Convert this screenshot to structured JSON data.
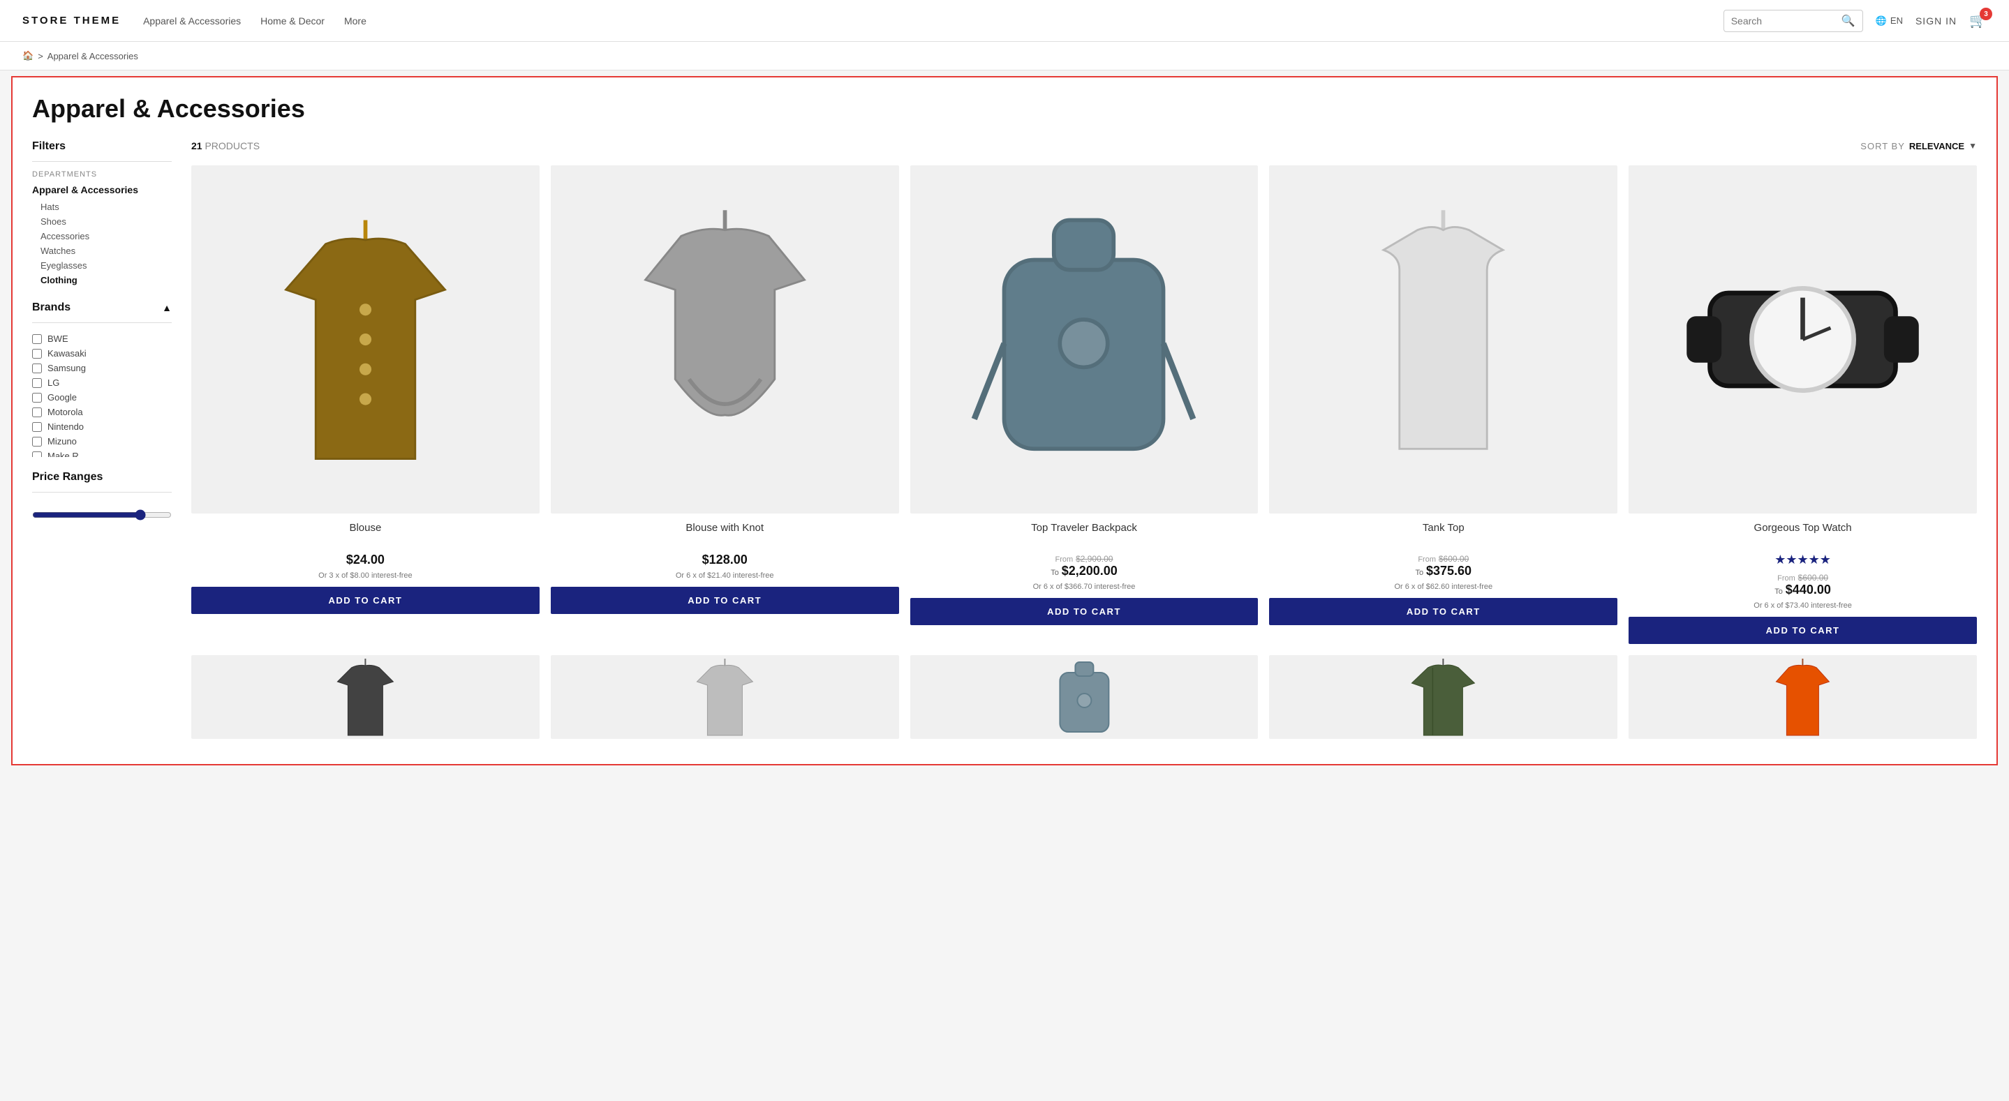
{
  "header": {
    "logo": "STORE THEME",
    "nav": [
      {
        "label": "Apparel & Accessories"
      },
      {
        "label": "Home & Decor"
      },
      {
        "label": "More"
      }
    ],
    "search_placeholder": "Search",
    "lang": "EN",
    "sign_in": "SIGN IN",
    "cart_count": "3"
  },
  "breadcrumb": {
    "home_icon": "🏠",
    "separator": ">",
    "current": "Apparel & Accessories"
  },
  "page": {
    "title": "Apparel & Accessories",
    "product_count": "21",
    "products_label": "PRODUCTS",
    "sort_by_label": "SORT BY",
    "sort_value": "RELEVANCE"
  },
  "filters": {
    "title": "Filters",
    "departments_label": "Departments",
    "departments_parent": "Apparel & Accessories",
    "departments_children": [
      {
        "label": "Hats"
      },
      {
        "label": "Shoes"
      },
      {
        "label": "Accessories"
      },
      {
        "label": "Watches"
      },
      {
        "label": "Eyeglasses"
      },
      {
        "label": "Clothing"
      }
    ],
    "brands_title": "Brands",
    "brands": [
      {
        "label": "BWE"
      },
      {
        "label": "Kawasaki"
      },
      {
        "label": "Samsung"
      },
      {
        "label": "LG"
      },
      {
        "label": "Google"
      },
      {
        "label": "Motorola"
      },
      {
        "label": "Nintendo"
      },
      {
        "label": "Mizuno"
      },
      {
        "label": "Make R"
      }
    ],
    "price_ranges_title": "Price Ranges"
  },
  "products": [
    {
      "name": "Blouse",
      "price": "$24.00",
      "has_range": false,
      "installment": "Or 3 x of $8.00 interest-free",
      "add_to_cart": "ADD TO CART",
      "has_stars": false,
      "icon": "blouse"
    },
    {
      "name": "Blouse with Knot",
      "price": "$128.00",
      "has_range": false,
      "installment": "Or 6 x of $21.40 interest-free",
      "add_to_cart": "ADD TO CART",
      "has_stars": false,
      "icon": "blouse-knot"
    },
    {
      "name": "Top Traveler Backpack",
      "price": "$2,200.00",
      "original_price": "$2,900.00",
      "has_range": true,
      "range_label_from": "From",
      "range_label_to": "To",
      "installment": "Or 6 x of $366.70 interest-free",
      "add_to_cart": "ADD TO CART",
      "has_stars": false,
      "icon": "backpack"
    },
    {
      "name": "Tank Top",
      "price": "$375.60",
      "original_price": "$600.00",
      "has_range": true,
      "range_label_from": "From",
      "range_label_to": "To",
      "installment": "Or 6 x of $62.60 interest-free",
      "add_to_cart": "ADD TO CART",
      "has_stars": false,
      "icon": "tank-top"
    },
    {
      "name": "Gorgeous Top Watch",
      "price": "$440.00",
      "original_price": "$600.00",
      "has_range": true,
      "range_label_from": "From",
      "range_label_to": "To",
      "installment": "Or 6 x of $73.40 interest-free",
      "add_to_cart": "ADD TO CART",
      "has_stars": true,
      "stars": "★★★★★",
      "icon": "watch"
    }
  ],
  "products_row2": [
    {
      "name": "",
      "icon": "dark-blouse",
      "partial": true
    },
    {
      "name": "",
      "icon": "gray-top",
      "partial": true
    },
    {
      "name": "",
      "icon": "backpack2",
      "partial": true
    },
    {
      "name": "",
      "icon": "green-jacket",
      "partial": true
    },
    {
      "name": "",
      "icon": "orange-item",
      "partial": true
    }
  ]
}
